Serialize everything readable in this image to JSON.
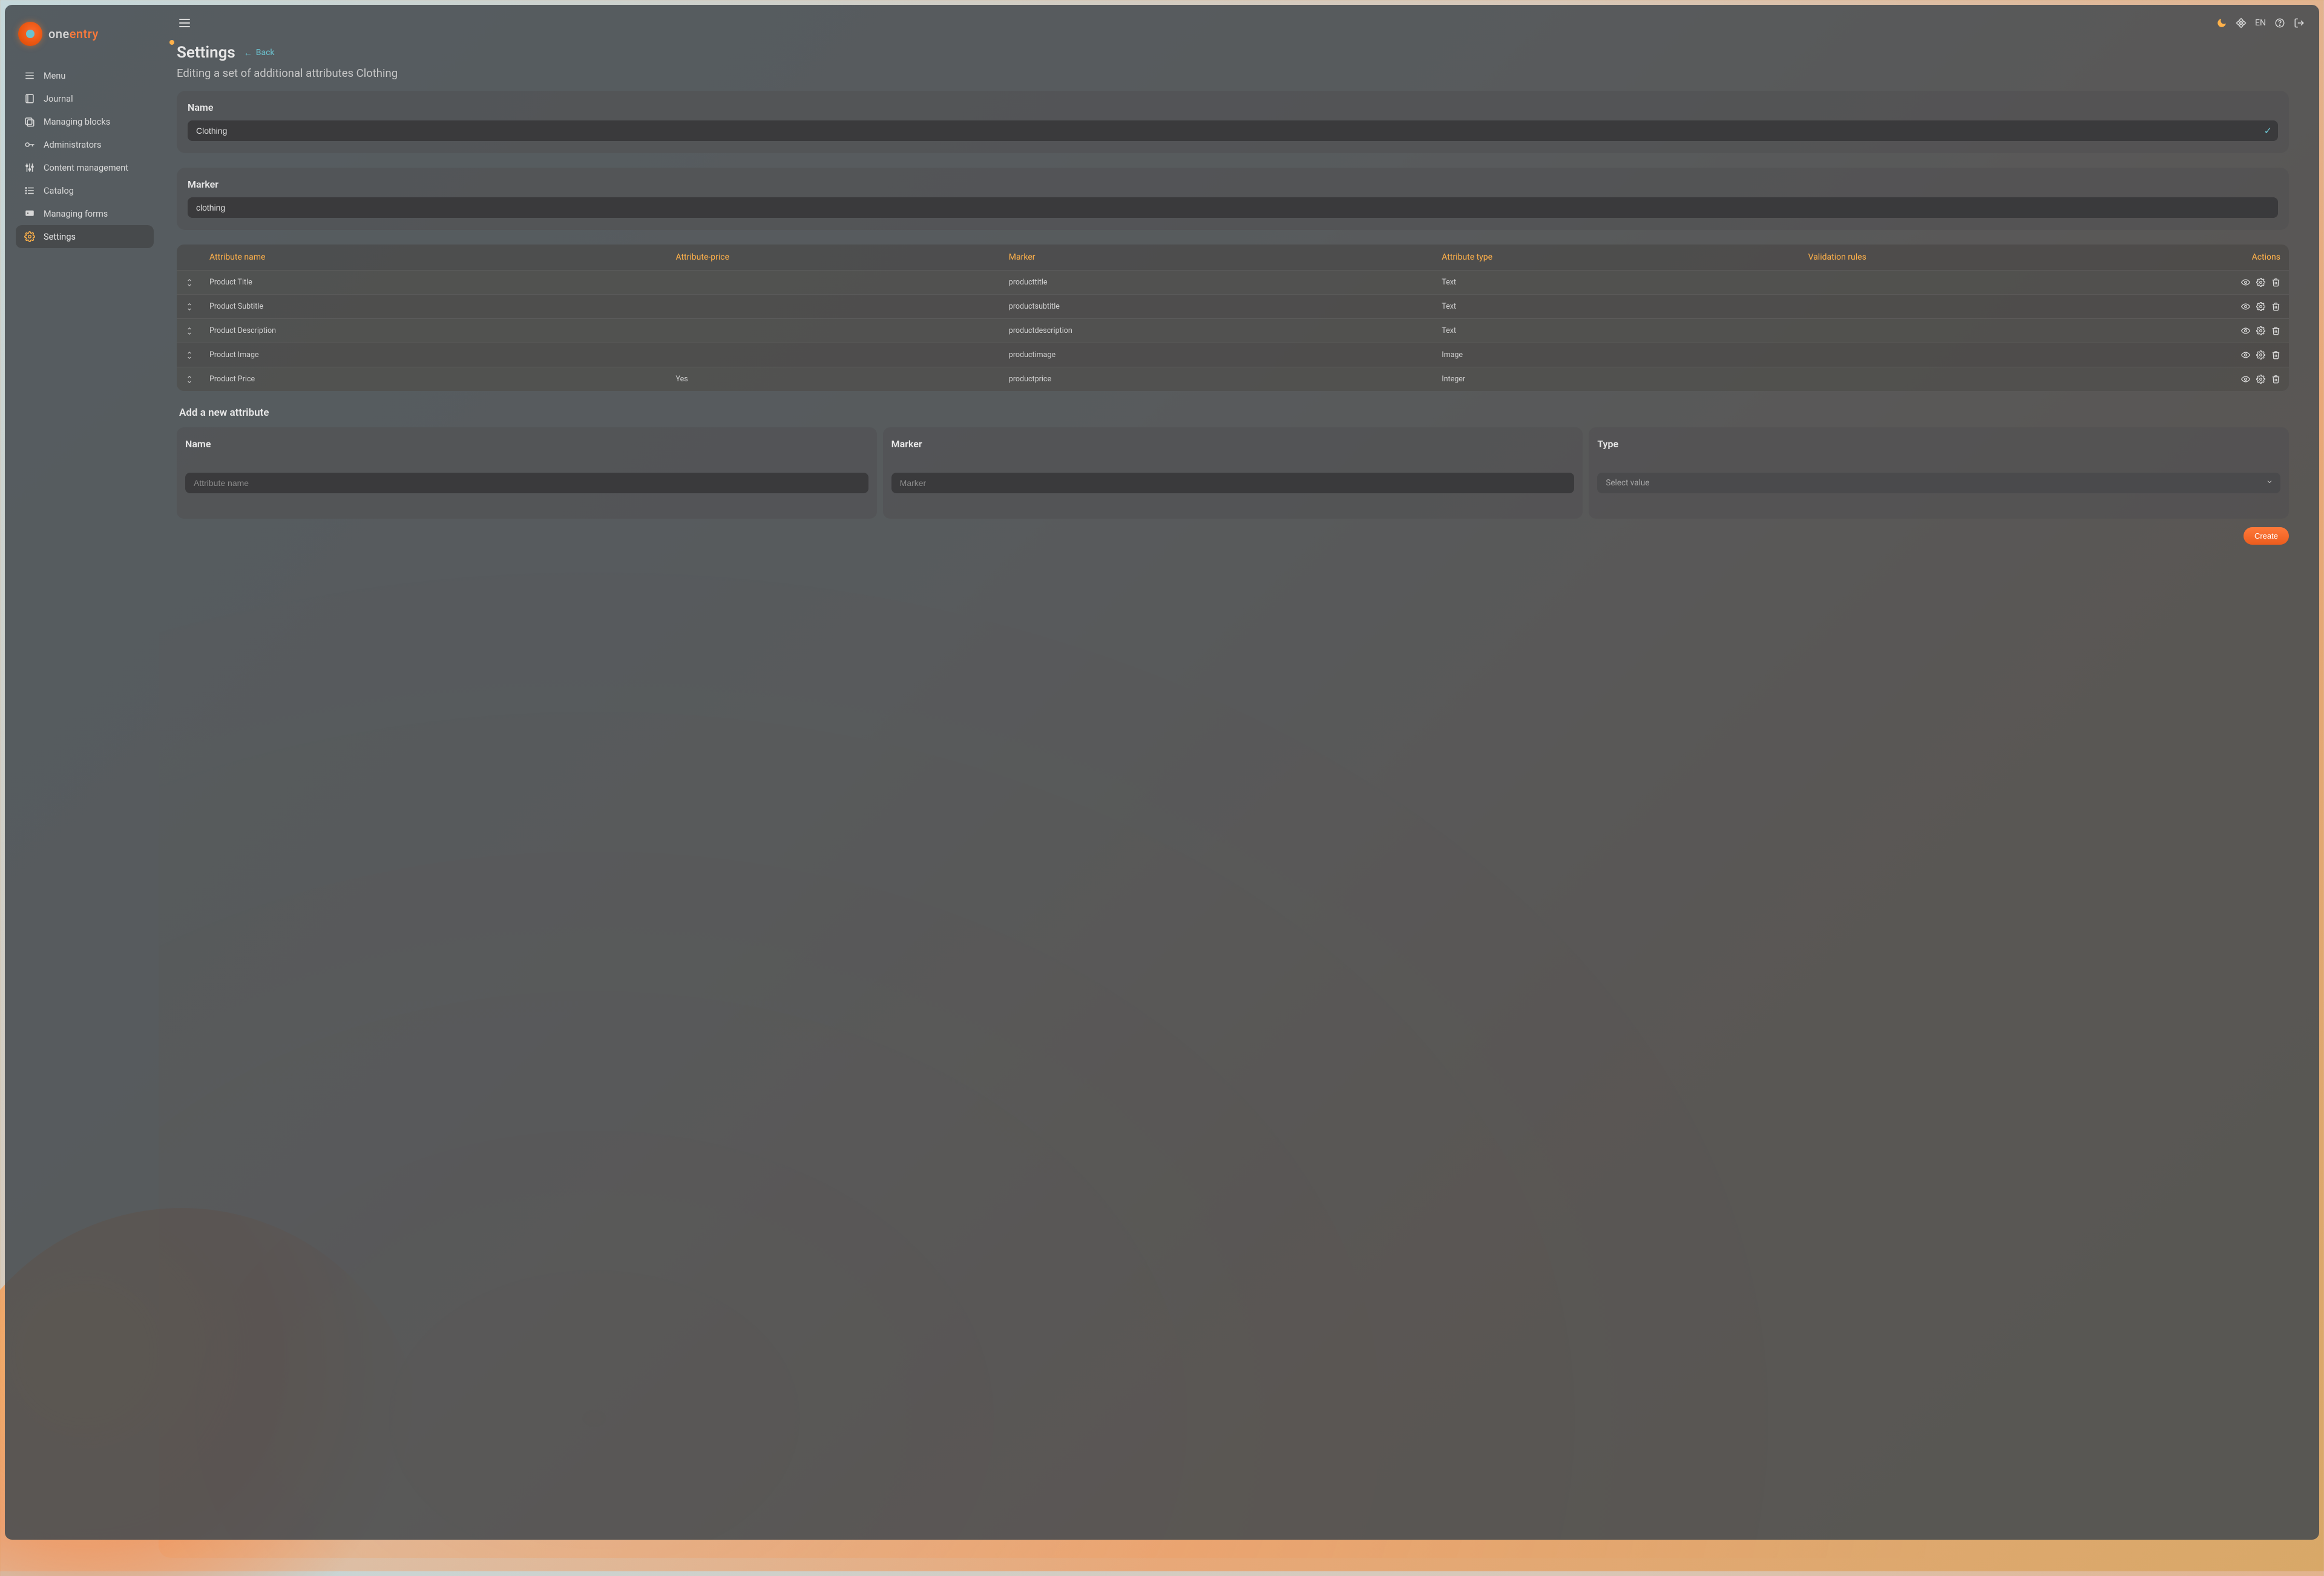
{
  "brand": {
    "one": "one",
    "entry": "entry"
  },
  "sidebar": {
    "items": [
      {
        "label": "Menu"
      },
      {
        "label": "Journal"
      },
      {
        "label": "Managing blocks"
      },
      {
        "label": "Administrators"
      },
      {
        "label": "Content management"
      },
      {
        "label": "Catalog"
      },
      {
        "label": "Managing forms"
      },
      {
        "label": "Settings"
      }
    ]
  },
  "topbar": {
    "lang": "EN"
  },
  "page": {
    "title": "Settings",
    "back": "Back",
    "subtitle": "Editing a set of additional attributes Clothing",
    "name_label": "Name",
    "name_value": "Clothing",
    "marker_label": "Marker",
    "marker_value": "clothing"
  },
  "table": {
    "headers": {
      "name": "Attribute name",
      "price": "Attribute-price",
      "marker": "Marker",
      "type": "Attribute type",
      "validation": "Validation rules",
      "actions": "Actions"
    },
    "rows": [
      {
        "name": "Product Title",
        "price": "",
        "marker": "producttitle",
        "type": "Text",
        "validation": ""
      },
      {
        "name": "Product Subtitle",
        "price": "",
        "marker": "productsubtitle",
        "type": "Text",
        "validation": ""
      },
      {
        "name": "Product Description",
        "price": "",
        "marker": "productdescription",
        "type": "Text",
        "validation": ""
      },
      {
        "name": "Product Image",
        "price": "",
        "marker": "productimage",
        "type": "Image",
        "validation": ""
      },
      {
        "name": "Product Price",
        "price": "Yes",
        "marker": "productprice",
        "type": "Integer",
        "validation": ""
      }
    ]
  },
  "new_attr": {
    "title": "Add a new attribute",
    "name_label": "Name",
    "name_placeholder": "Attribute name",
    "marker_label": "Marker",
    "marker_placeholder": "Marker",
    "type_label": "Type",
    "type_placeholder": "Select value",
    "create": "Create"
  }
}
